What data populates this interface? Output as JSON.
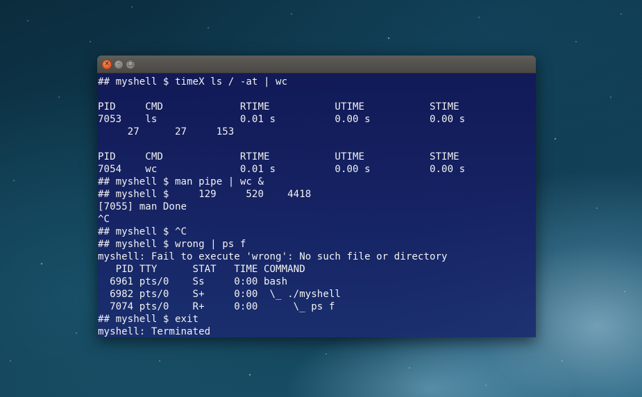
{
  "window": {
    "title": "",
    "buttons": {
      "close_glyph": "×",
      "minimize_glyph": "–",
      "maximize_glyph": "□"
    }
  },
  "terminal": {
    "lines": [
      "## myshell $ timeX ls / -at | wc",
      "",
      "PID     CMD             RTIME           UTIME           STIME",
      "7053    ls              0.01 s          0.00 s          0.00 s",
      "     27      27     153",
      "",
      "PID     CMD             RTIME           UTIME           STIME",
      "7054    wc              0.01 s          0.00 s          0.00 s",
      "## myshell $ man pipe | wc &",
      "## myshell $     129     520    4418",
      "[7055] man Done",
      "^C",
      "## myshell $ ^C",
      "## myshell $ wrong | ps f",
      "myshell: Fail to execute 'wrong': No such file or directory",
      "   PID TTY      STAT   TIME COMMAND",
      "  6961 pts/0    Ss     0:00 bash",
      "  6982 pts/0    S+     0:00  \\_ ./myshell",
      "  7074 pts/0    R+     0:00      \\_ ps f",
      "## myshell $ exit",
      "myshell: Terminated"
    ]
  },
  "colors": {
    "terminal_bg": "#141c5c",
    "terminal_text": "#f2f2f2",
    "close_button": "#e2561f",
    "titlebar": "#55534e"
  }
}
